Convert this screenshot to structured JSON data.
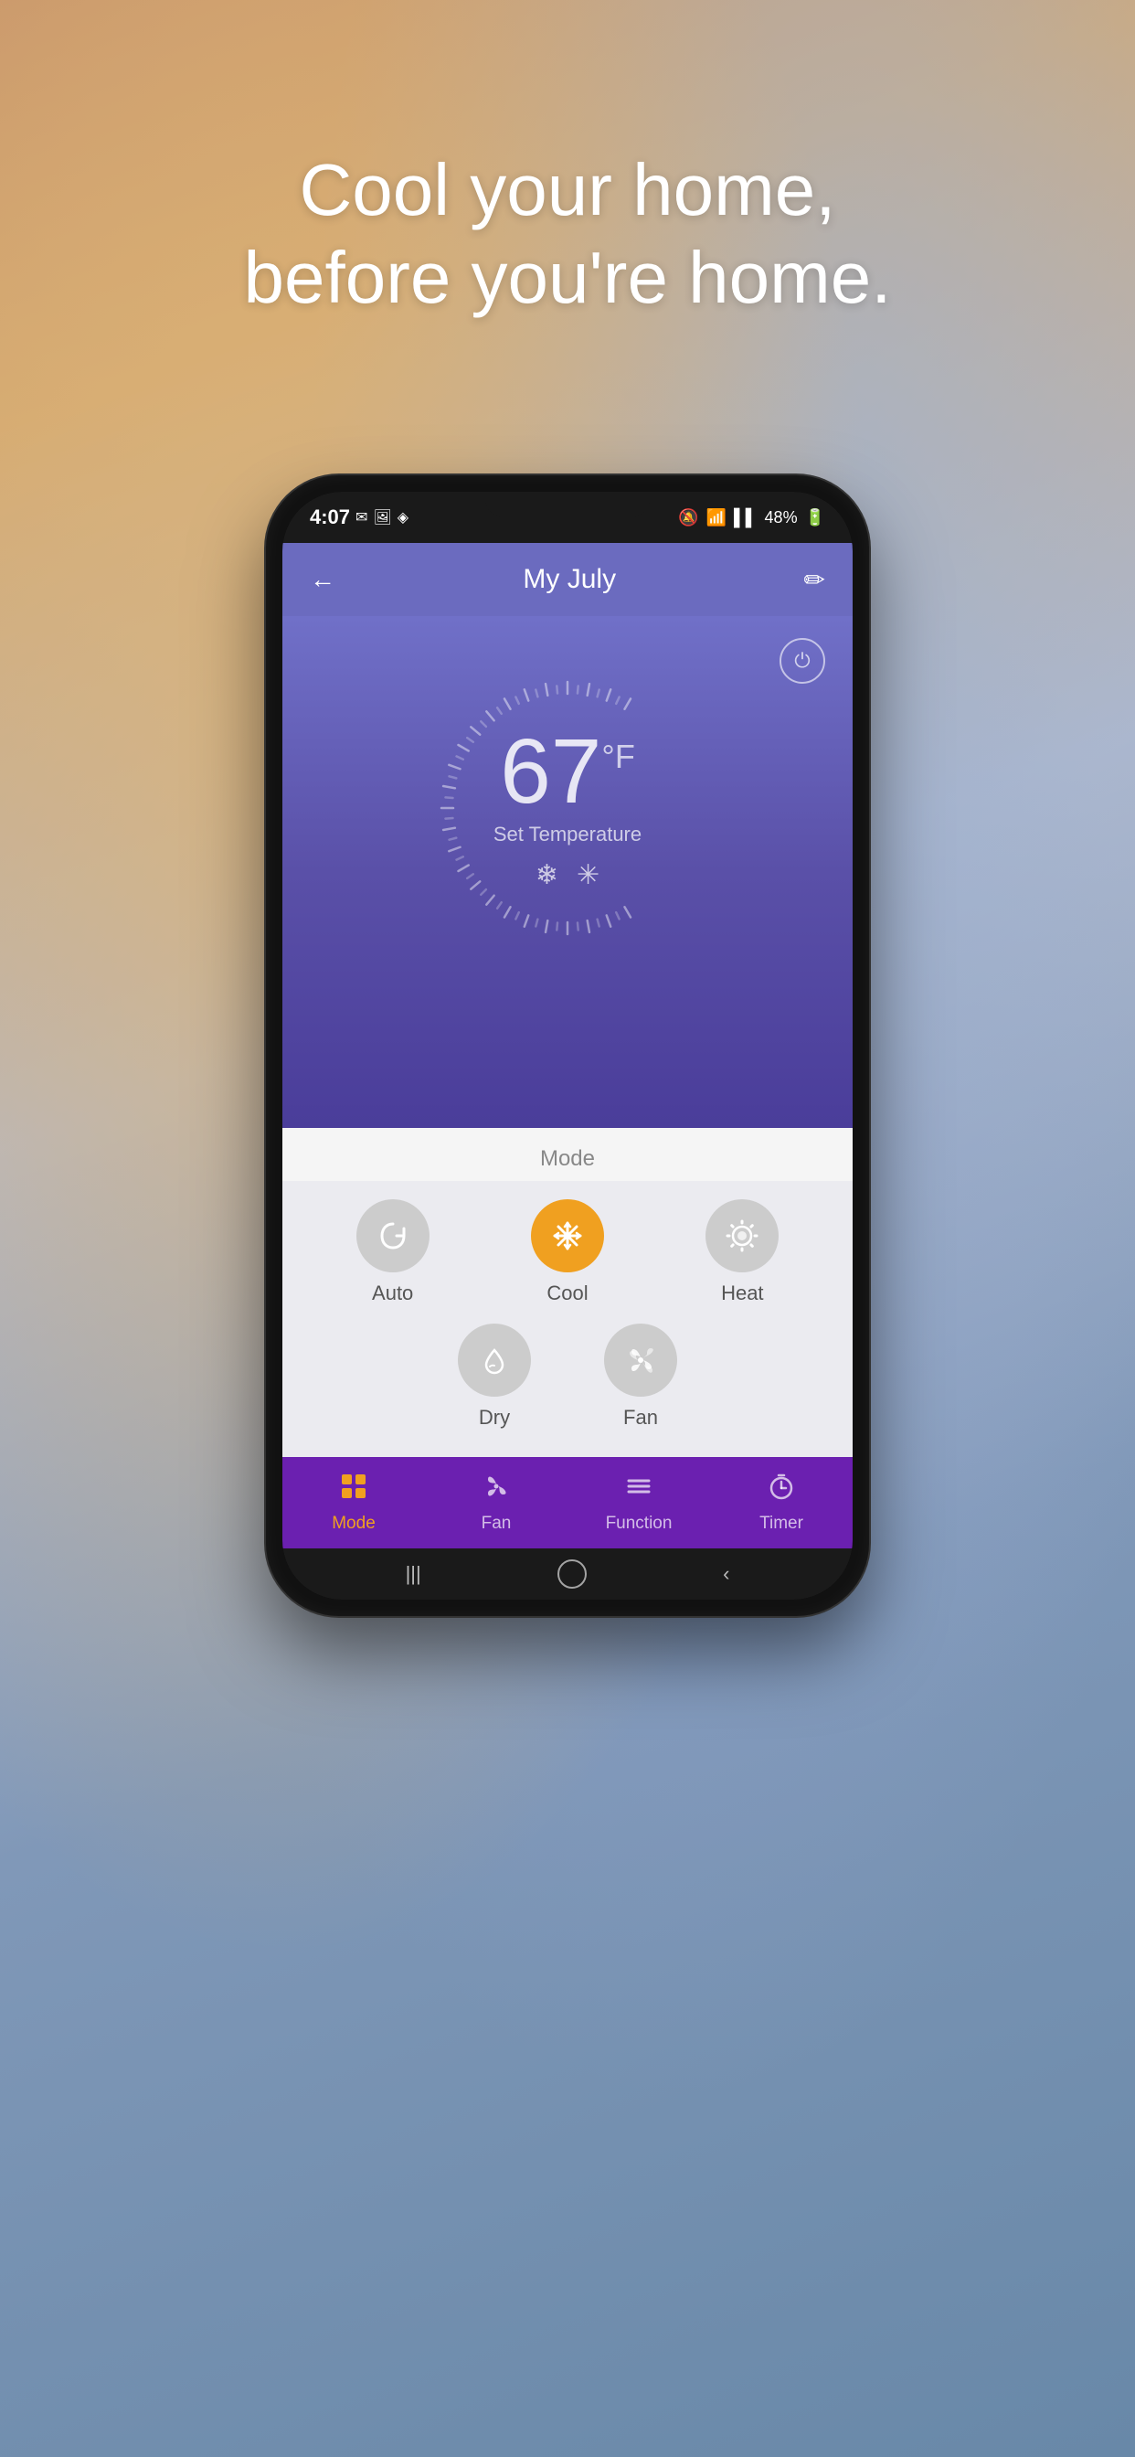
{
  "background": {
    "tagline_line1": "Cool your home,",
    "tagline_line2": "before you're home."
  },
  "status_bar": {
    "time": "4:07",
    "icons": "🔕 📶 48%",
    "battery": "48%"
  },
  "header": {
    "title": "My July",
    "back_label": "←",
    "edit_label": "✏"
  },
  "thermostat": {
    "temperature": "67",
    "unit": "°F",
    "set_temp_label": "Set Temperature",
    "power_icon": "⏻"
  },
  "mode_panel": {
    "title": "Mode",
    "modes": [
      {
        "id": "auto",
        "label": "Auto",
        "icon": "♻",
        "active": false
      },
      {
        "id": "cool",
        "label": "Cool",
        "icon": "❄",
        "active": true
      },
      {
        "id": "heat",
        "label": "Heat",
        "icon": "☀",
        "active": false
      },
      {
        "id": "dry",
        "label": "Dry",
        "icon": "💧",
        "active": false
      },
      {
        "id": "fan",
        "label": "Fan",
        "icon": "✳",
        "active": false
      }
    ]
  },
  "bottom_nav": {
    "items": [
      {
        "id": "mode",
        "label": "Mode",
        "icon": "⊞",
        "active": true
      },
      {
        "id": "fan",
        "label": "Fan",
        "icon": "✳",
        "active": false
      },
      {
        "id": "function",
        "label": "Function",
        "icon": "≡",
        "active": false
      },
      {
        "id": "timer",
        "label": "Timer",
        "icon": "⏱",
        "active": false
      }
    ]
  },
  "android_nav": {
    "back": "‹",
    "home": "○",
    "recent": "|||"
  }
}
